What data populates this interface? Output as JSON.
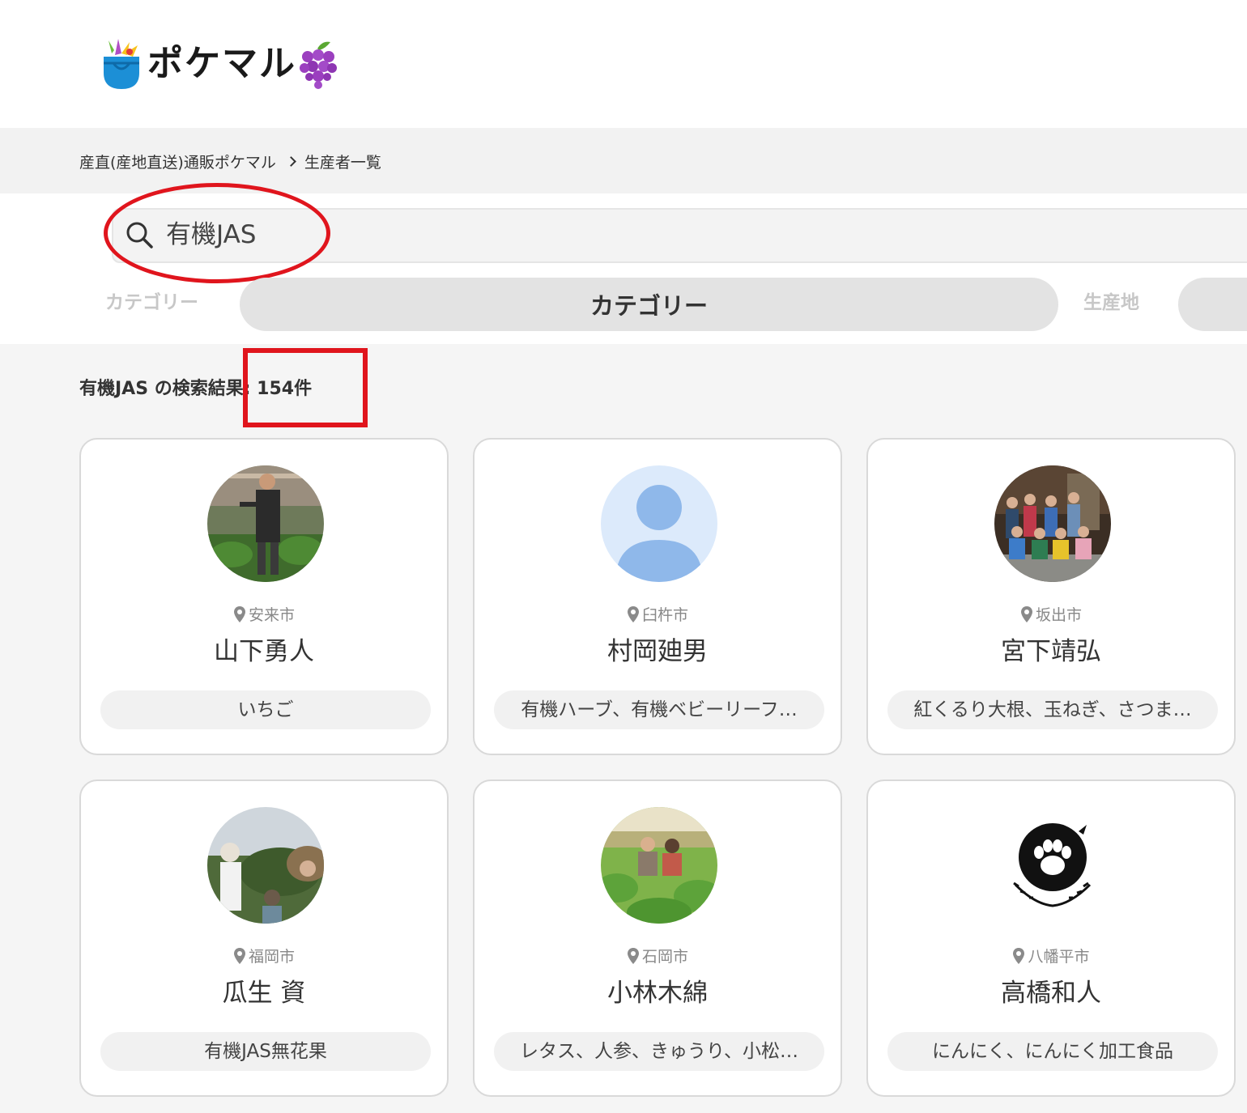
{
  "brand": {
    "logo_text": "ポケマル"
  },
  "breadcrumb": {
    "home": "産直(産地直送)通販ポケマル",
    "current": "生産者一覧"
  },
  "search": {
    "value": "有機JAS"
  },
  "filters": [
    {
      "label": "カテゴリー",
      "value": "カテゴリー"
    },
    {
      "label": "生産地",
      "value": ""
    }
  ],
  "results": {
    "text": "有機JAS の検索結果: 154件"
  },
  "colors": {
    "annotation_red": "#e0151d",
    "default_avatar_bg": "#dceafb",
    "default_avatar_fg": "#8fb8ea"
  },
  "producers": [
    {
      "location": "安来市",
      "name": "山下勇人",
      "products": "いちご",
      "avatar": "photo-strawberry-farmer"
    },
    {
      "location": "臼杵市",
      "name": "村岡廸男",
      "products": "有機ハーブ、有機ベビーリーフ…",
      "avatar": "default-user-icon"
    },
    {
      "location": "坂出市",
      "name": "宮下靖弘",
      "products": "紅くるり大根、玉ねぎ、さつま…",
      "avatar": "photo-group"
    },
    {
      "location": "福岡市",
      "name": "瓜生 資",
      "products": "有機JAS無花果",
      "avatar": "photo-fig-farm"
    },
    {
      "location": "石岡市",
      "name": "小林木綿",
      "products": "レタス、人参、きゅうり、小松…",
      "avatar": "photo-vegetable-field"
    },
    {
      "location": "八幡平市",
      "name": "高橋和人",
      "products": "にんにく、にんにく加工食品",
      "avatar": "paw-logo-icon"
    }
  ]
}
